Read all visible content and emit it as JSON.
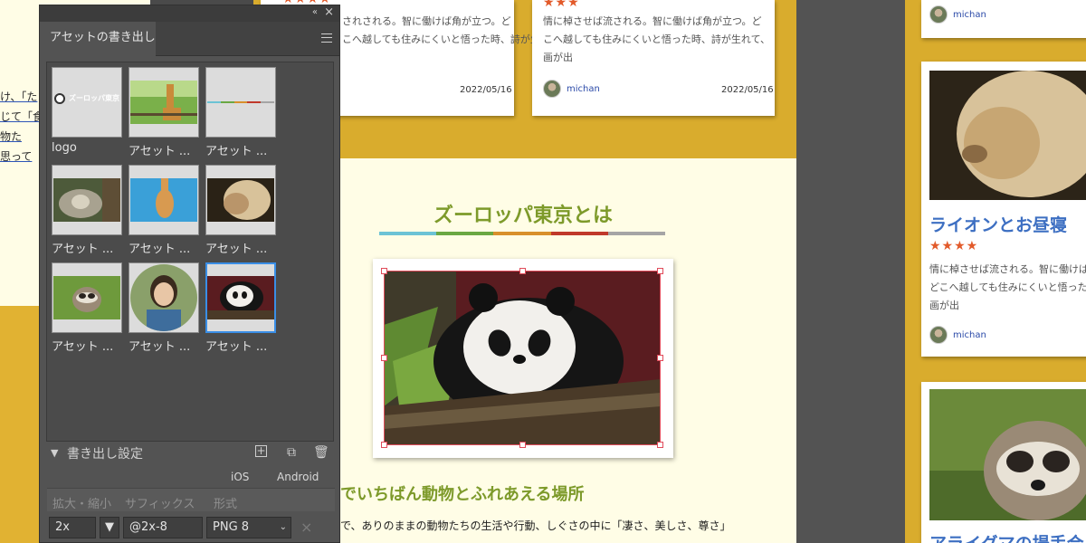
{
  "left_page": {
    "lines": [
      "け、「た",
      "じて「食",
      "物た",
      "思って"
    ]
  },
  "center_page": {
    "top_card_left": {
      "stars": "★★★★",
      "text_line1": "されされる。智に働けば角が立つ。ど",
      "text_line2": "こへ越しても住みにくいと悟った時、詩が生れて、",
      "date": "2022/05/16"
    },
    "top_card_right": {
      "stars": "★★★",
      "text_line1": "情に棹させば流される。智に働けば角が立つ。ど",
      "text_line2": "こへ越しても住みにくいと悟った時、詩が生れて、",
      "text_line3": "画が出",
      "author": "michan",
      "date": "2022/05/16"
    },
    "section_title": "ズーロッパ東京とは",
    "title_bar_colors": [
      "#6cc3d5",
      "#6aa843",
      "#d8902c",
      "#c0392b",
      "#a5a5a5"
    ],
    "sub_heading": "でいちばん動物とふれあえる場所",
    "body_line1": "で、ありのままの動物たちの生活や行動、しぐさの中に「凄さ、美しさ、尊さ」",
    "body_line2": ""
  },
  "right_page": {
    "top_author": "michan",
    "lion_card": {
      "title": "ライオンとお昼寝",
      "stars": "★★★★",
      "text_line1": "情に棹させば流される。智に働けば",
      "text_line2": "どこへ越しても住みにくいと悟った",
      "text_line3": "画が出",
      "author": "michan"
    },
    "raccoon_card": {
      "title": "アライグマの場手合"
    }
  },
  "panel": {
    "title": "アセットの書き出し",
    "collapse_icon": "«",
    "close_icon": "×",
    "assets": [
      {
        "label": "logo",
        "kind": "logo",
        "logo_text": "ズーロッパ東京"
      },
      {
        "label": "アセット ...",
        "kind": "giraffe-field"
      },
      {
        "label": "アセット ...",
        "kind": "color-line"
      },
      {
        "label": "アセット ...",
        "kind": "tiger"
      },
      {
        "label": "アセット ...",
        "kind": "giraffe-sky"
      },
      {
        "label": "アセット ...",
        "kind": "lion"
      },
      {
        "label": "アセット ...",
        "kind": "raccoon"
      },
      {
        "label": "アセット ...",
        "kind": "person"
      },
      {
        "label": "アセット ...",
        "kind": "panda"
      }
    ],
    "settings": {
      "label": "書き出し設定",
      "toggle_icon": "▼",
      "platform_ios": "iOS",
      "platform_android": "Android",
      "col_scale": "拡大・縮小",
      "col_suffix": "サフィックス",
      "col_format": "形式",
      "scale_value": "2x",
      "suffix_value": "@2x-8",
      "format_value": "PNG 8",
      "remove_icon": "×"
    }
  }
}
